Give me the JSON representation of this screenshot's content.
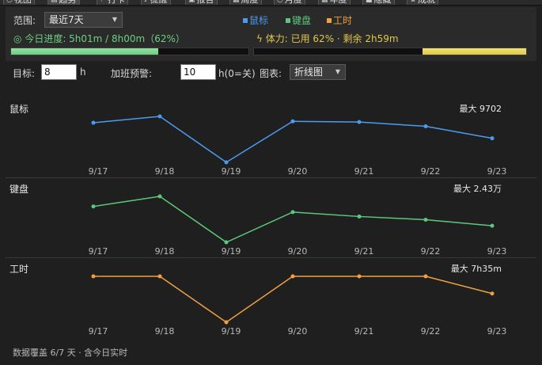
{
  "tabs": [
    {
      "icon": "clock-icon",
      "label": "视图"
    },
    {
      "icon": "chart-icon",
      "label": "趋势"
    },
    {
      "icon": "flag-icon",
      "label": "打卡"
    },
    {
      "icon": "bell-icon",
      "label": "提醒"
    },
    {
      "icon": "doc-icon",
      "label": "报告"
    },
    {
      "icon": "calendar-icon",
      "label": "周度"
    },
    {
      "icon": "clock-icon",
      "label": "月度"
    },
    {
      "icon": "calendar-icon",
      "label": "年度"
    },
    {
      "icon": "lock-icon",
      "label": "隐藏"
    },
    {
      "icon": "trophy-icon",
      "label": "成就"
    }
  ],
  "range": {
    "label": "范围:",
    "value": "最近7天"
  },
  "legend": [
    {
      "label": "鼠标",
      "color": "#4a9cf0"
    },
    {
      "label": "键盘",
      "color": "#5cc97a"
    },
    {
      "label": "工时",
      "color": "#f0a040"
    }
  ],
  "today_progress": {
    "icon": "target-icon",
    "text": "今日进度: 5h01m / 8h00m（62%）",
    "fraction": 0.62,
    "color": "#6ecf82"
  },
  "stamina": {
    "icon": "bolt-icon",
    "text": "体力: 已用 62% · 剩余 2h59m",
    "remaining_fraction": 0.38,
    "color": "#e0c84a"
  },
  "controls": {
    "target_label": "目标:",
    "target_value": "8",
    "target_unit": "h",
    "overtime_label": "加班预警:",
    "overtime_value": "10",
    "overtime_unit": "h(0=关)",
    "chart_label": "图表:",
    "chart_type": "折线图"
  },
  "chart_data": [
    {
      "type": "line",
      "title": "鼠标",
      "max_label": "最大 9702",
      "x": [
        "9/17",
        "9/18",
        "9/19",
        "9/20",
        "9/21",
        "9/22",
        "9/23"
      ],
      "series": [
        {
          "values": [
            8800,
            9702,
            3200,
            9000,
            8900,
            8300,
            6600
          ],
          "color": "#4a9cf0"
        }
      ],
      "ylim": [
        0,
        9702
      ],
      "grid": false
    },
    {
      "type": "line",
      "title": "键盘",
      "max_label": "最大 2.43万",
      "x": [
        "9/17",
        "9/18",
        "9/19",
        "9/20",
        "9/21",
        "9/22",
        "9/23"
      ],
      "series": [
        {
          "values": [
            21800,
            24300,
            12900,
            20400,
            19300,
            18500,
            17000
          ],
          "color": "#5cc97a"
        }
      ],
      "ylim": [
        0,
        24300
      ],
      "grid": false
    },
    {
      "type": "line",
      "title": "工时",
      "max_label": "最大 7h35m",
      "x": [
        "9/17",
        "9/18",
        "9/19",
        "9/20",
        "9/21",
        "9/22",
        "9/23"
      ],
      "series": [
        {
          "values": [
            7.58,
            7.58,
            3.1,
            7.58,
            7.58,
            7.58,
            5.9
          ],
          "color": "#f0a040"
        }
      ],
      "ylim": [
        0,
        7.58
      ],
      "grid": false
    }
  ],
  "footer": "数据覆盖 6/7 天 · 含今日实时"
}
